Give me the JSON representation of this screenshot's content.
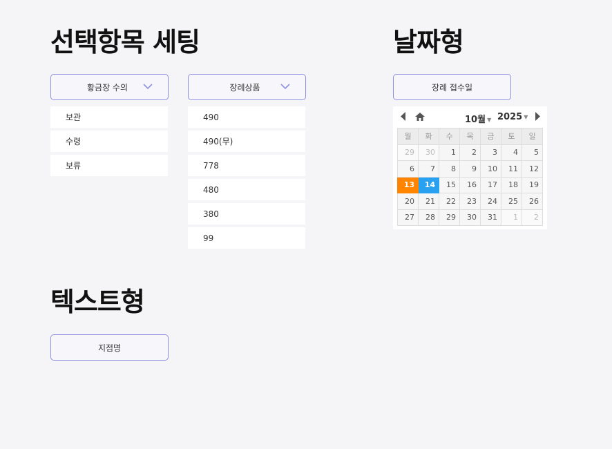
{
  "sections": {
    "select": {
      "title": "선택항목 세팅"
    },
    "date": {
      "title": "날짜형"
    },
    "text": {
      "title": "텍스트형"
    }
  },
  "select1": {
    "label": "황금장 수의",
    "options": [
      "보관",
      "수령",
      "보류"
    ]
  },
  "select2": {
    "label": "장례상품",
    "options": [
      "490",
      "490(무)",
      "778",
      "480",
      "380",
      "99"
    ]
  },
  "date_field": {
    "label": "장례 접수일"
  },
  "text_field": {
    "label": "지점명"
  },
  "calendar": {
    "month": "10월",
    "year": "2025",
    "weekdays": [
      "월",
      "화",
      "수",
      "목",
      "금",
      "토",
      "일"
    ],
    "weeks": [
      [
        "29",
        "30",
        "1",
        "2",
        "3",
        "4",
        "5"
      ],
      [
        "6",
        "7",
        "8",
        "9",
        "10",
        "11",
        "12"
      ],
      [
        "13",
        "14",
        "15",
        "16",
        "17",
        "18",
        "19"
      ],
      [
        "20",
        "21",
        "22",
        "23",
        "24",
        "25",
        "26"
      ],
      [
        "27",
        "28",
        "29",
        "30",
        "31",
        "1",
        "2"
      ]
    ],
    "highlight_colors": {
      "orange": "#ff8400",
      "blue": "#2aa0f0"
    }
  },
  "colors": {
    "accent_border": "#8d8fe0",
    "background": "#f5f4f6"
  }
}
